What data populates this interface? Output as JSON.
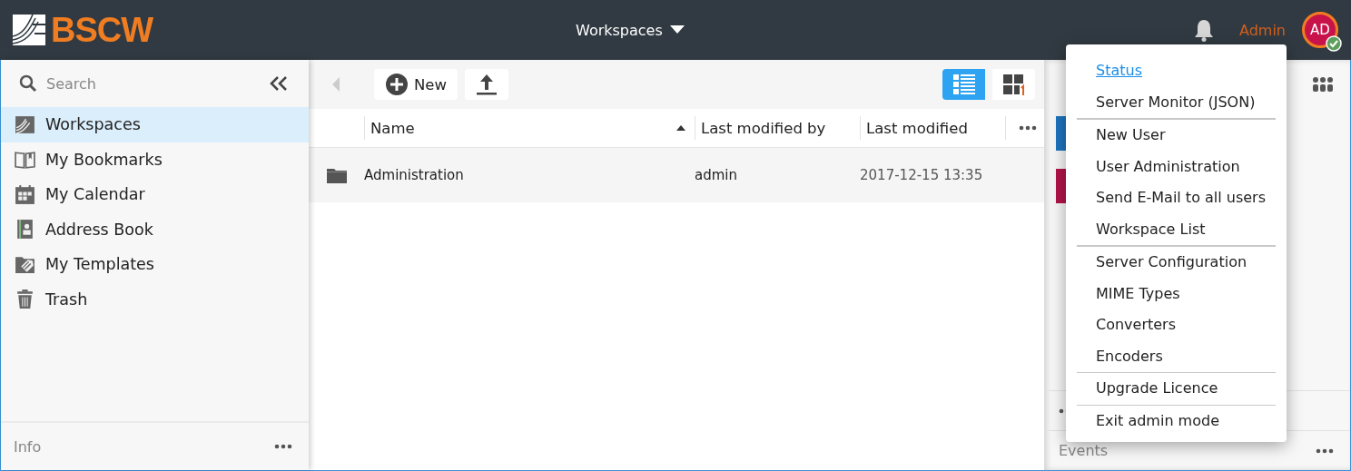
{
  "header": {
    "logo": "BSCW",
    "nav": "Workspaces",
    "user": "Admin",
    "avatar": {
      "initials": "AD",
      "online": true
    }
  },
  "sidebar": {
    "search": {
      "placeholder": "Search"
    },
    "items": [
      {
        "label": "Workspaces",
        "kind": "workspaces",
        "selected": true
      },
      {
        "label": "My Bookmarks",
        "kind": "bookmarks",
        "selected": false
      },
      {
        "label": "My Calendar",
        "kind": "calendar",
        "selected": false
      },
      {
        "label": "Address Book",
        "kind": "addressbook",
        "selected": false
      },
      {
        "label": "My Templates",
        "kind": "templates",
        "selected": false
      },
      {
        "label": "Trash",
        "kind": "trash",
        "selected": false
      }
    ],
    "footer": "Info"
  },
  "toolbar": {
    "new": "New",
    "views": [
      {
        "kind": "list",
        "selected": true
      },
      {
        "kind": "grid",
        "selected": false
      }
    ]
  },
  "table": {
    "columns": [
      "Name",
      "Last modified by",
      "Last modified"
    ],
    "rows": [
      {
        "name": "Administration",
        "by": "admin",
        "modified": "2017-12-15 13:35"
      }
    ]
  },
  "right_panel": {
    "sections": [
      "Events"
    ]
  },
  "menu": {
    "groups": [
      [
        {
          "label": "Status",
          "kind": "link"
        },
        {
          "label": "Server Monitor (JSON)",
          "kind": "item"
        }
      ],
      [
        {
          "label": "New User",
          "kind": "item"
        },
        {
          "label": "User Administration",
          "kind": "item"
        },
        {
          "label": "Send E-Mail to all users",
          "kind": "item"
        },
        {
          "label": "Workspace List",
          "kind": "item"
        }
      ],
      [
        {
          "label": "Server Configuration",
          "kind": "item"
        },
        {
          "label": "MIME Types",
          "kind": "item"
        },
        {
          "label": "Converters",
          "kind": "item"
        },
        {
          "label": "Encoders",
          "kind": "item"
        }
      ],
      [
        {
          "label": "Upgrade Licence",
          "kind": "item"
        }
      ],
      [
        {
          "label": "Exit admin mode",
          "kind": "item"
        }
      ]
    ]
  }
}
